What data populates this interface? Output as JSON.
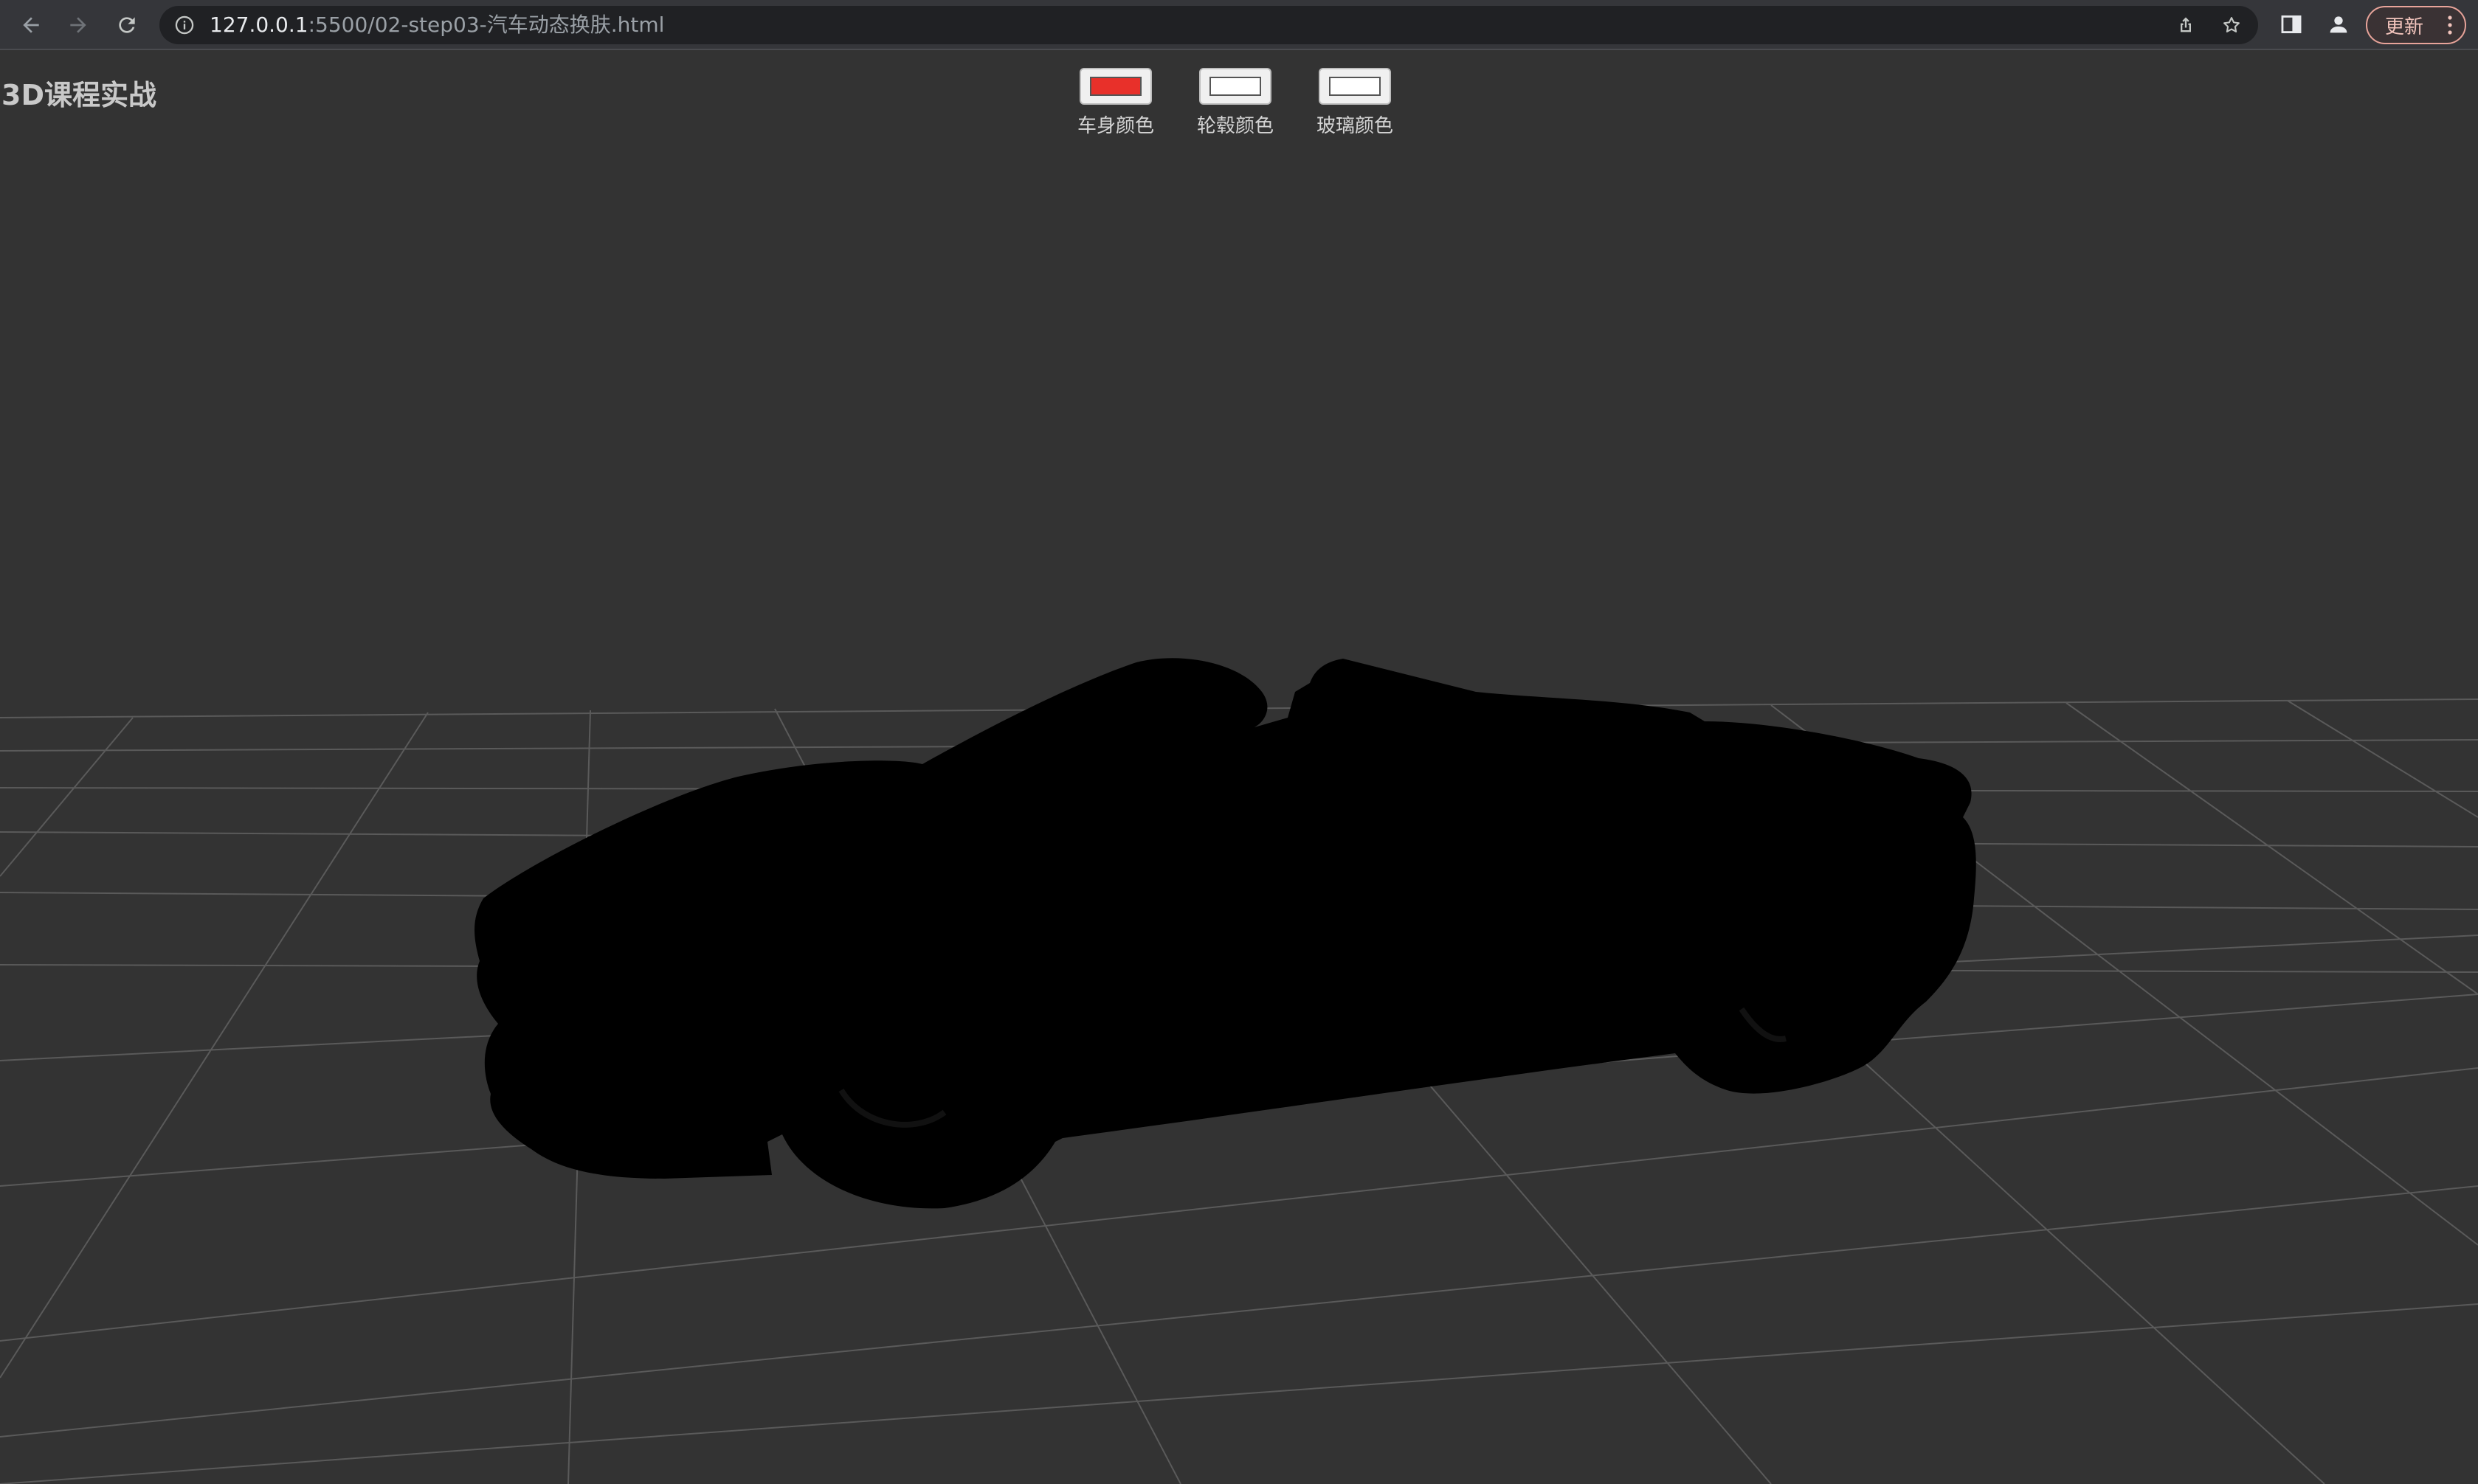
{
  "browser": {
    "url_host": "127.0.0.1",
    "url_rest": ":5500/02-step03-汽车动态换肤.html",
    "update_label": "更新"
  },
  "page": {
    "title": "3D课程实战",
    "controls": [
      {
        "label": "车身颜色",
        "color": "#e8302a"
      },
      {
        "label": "轮毂颜色",
        "color": "#ffffff"
      },
      {
        "label": "玻璃颜色",
        "color": "#ffffff"
      }
    ]
  },
  "icons": {
    "back": "arrow-left-icon",
    "forward": "arrow-right-icon",
    "reload": "reload-icon",
    "site_info": "info-icon",
    "share": "share-icon",
    "bookmark": "star-icon",
    "side_panel": "side-panel-icon",
    "profile": "profile-icon",
    "menu": "more-vert-icon"
  },
  "colors": {
    "background": "#333333",
    "grid": "#5a5a5a",
    "car": "#000000"
  }
}
